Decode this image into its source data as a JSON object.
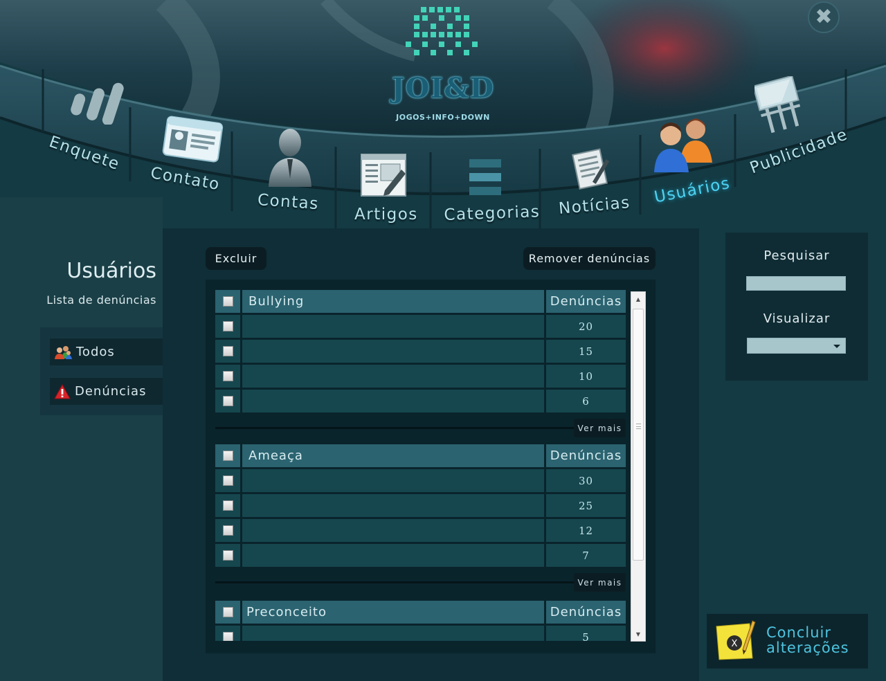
{
  "app": {
    "logo_text": "JOI&D",
    "logo_subtitle": "JOGOS+INFO+DOWN"
  },
  "colors": {
    "background": "#143a43",
    "panel": "#0f2e37",
    "table_header": "#2b6370",
    "table_row": "#16474f",
    "active_nav": "#4fd3f2",
    "accent_button_text": "#4fc4df"
  },
  "nav": {
    "items": [
      {
        "label": "Enquete",
        "icon": "bar-chart-icon"
      },
      {
        "label": "Contato",
        "icon": "id-card-icon"
      },
      {
        "label": "Contas",
        "icon": "user-icon"
      },
      {
        "label": "Artigos",
        "icon": "article-edit-icon"
      },
      {
        "label": "Categorias",
        "icon": "categories-icon"
      },
      {
        "label": "Notícias",
        "icon": "news-document-icon"
      },
      {
        "label": "Usuários",
        "icon": "users-icon",
        "active": true
      },
      {
        "label": "Publicidade",
        "icon": "billboard-icon"
      }
    ]
  },
  "sidebar": {
    "title": "Usuários",
    "subtitle": "Lista de denúncias",
    "items": [
      {
        "label": "Todos",
        "icon": "users-icon"
      },
      {
        "label": "Denúncias",
        "icon": "warning-icon"
      }
    ]
  },
  "toolbar": {
    "delete_label": "Excluir",
    "remove_reports_label": "Remover denúncias"
  },
  "report_groups": [
    {
      "category": "Bullying",
      "count_header": "Denúncias",
      "rows": [
        {
          "name": "",
          "count": "20"
        },
        {
          "name": "",
          "count": "15"
        },
        {
          "name": "",
          "count": "10"
        },
        {
          "name": "",
          "count": "6"
        }
      ],
      "more_label": "Ver mais"
    },
    {
      "category": "Ameaça",
      "count_header": "Denúncias",
      "rows": [
        {
          "name": "",
          "count": "30"
        },
        {
          "name": "",
          "count": "25"
        },
        {
          "name": "",
          "count": "12"
        },
        {
          "name": "",
          "count": "7"
        }
      ],
      "more_label": "Ver mais"
    },
    {
      "category": "Preconceito",
      "count_header": "Denúncias",
      "rows": [
        {
          "name": "",
          "count": "5"
        }
      ]
    }
  ],
  "search": {
    "label": "Pesquisar",
    "value": "",
    "view_label": "Visualizar",
    "view_selected": ""
  },
  "actions": {
    "conclude_line1": "Concluir",
    "conclude_line2": "alterações"
  }
}
